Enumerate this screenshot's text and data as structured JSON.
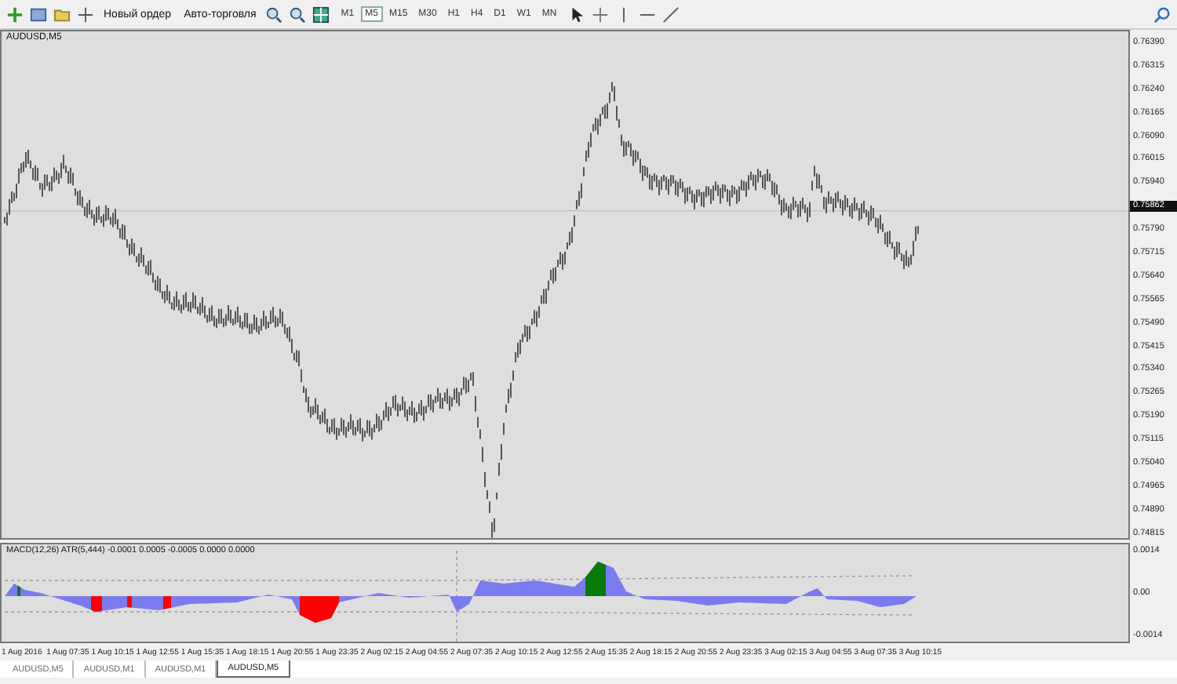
{
  "toolbar": {
    "buttons": [
      {
        "label": "Новый ордер"
      },
      {
        "label": "Авто-торговля"
      }
    ],
    "timeframes": [
      {
        "label": "M1",
        "selected": false
      },
      {
        "label": "M5",
        "selected": true
      },
      {
        "label": "M15",
        "selected": false
      },
      {
        "label": "M30",
        "selected": false
      },
      {
        "label": "H1",
        "selected": false
      },
      {
        "label": "H4",
        "selected": false
      },
      {
        "label": "D1",
        "selected": false
      },
      {
        "label": "W1",
        "selected": false
      },
      {
        "label": "MN",
        "selected": false
      }
    ]
  },
  "chart": {
    "title": "AUDUSD,M5",
    "price_axis": [
      {
        "label": "0.76390",
        "current": false
      },
      {
        "label": "0.76315",
        "current": false
      },
      {
        "label": "0.76240",
        "current": false
      },
      {
        "label": "0.76165",
        "current": false
      },
      {
        "label": "0.76090",
        "current": false
      },
      {
        "label": "0.76015",
        "current": false
      },
      {
        "label": "0.75940",
        "current": false
      },
      {
        "label": "0.75862",
        "current": true
      },
      {
        "label": "0.75790",
        "current": false
      },
      {
        "label": "0.75715",
        "current": false
      },
      {
        "label": "0.75640",
        "current": false
      },
      {
        "label": "0.75565",
        "current": false
      },
      {
        "label": "0.75490",
        "current": false
      },
      {
        "label": "0.75415",
        "current": false
      },
      {
        "label": "0.75340",
        "current": false
      },
      {
        "label": "0.75265",
        "current": false
      },
      {
        "label": "0.75190",
        "current": false
      },
      {
        "label": "0.75115",
        "current": false
      },
      {
        "label": "0.75040",
        "current": false
      },
      {
        "label": "0.74965",
        "current": false
      },
      {
        "label": "0.74890",
        "current": false
      },
      {
        "label": "0.74815",
        "current": false
      }
    ]
  },
  "indicator": {
    "title": "MACD(12,26) ATR(5,444) -0.0001 0.0005 -0.0005 0.0000 0.0000",
    "axis": [
      "0.0014",
      "0.00",
      "-0.0014"
    ]
  },
  "time_axis": [
    "1 Aug 2016",
    "1 Aug 07:35",
    "1 Aug 10:15",
    "1 Aug 12:55",
    "1 Aug 15:35",
    "1 Aug 18:15",
    "1 Aug 20:55",
    "1 Aug 23:35",
    "2 Aug 02:15",
    "2 Aug 04:55",
    "2 Aug 07:35",
    "2 Aug 10:15",
    "2 Aug 12:55",
    "2 Aug 15:35",
    "2 Aug 18:15",
    "2 Aug 20:55",
    "2 Aug 23:35",
    "3 Aug 02:15",
    "3 Aug 04:55",
    "3 Aug 07:35",
    "3 Aug 10:15"
  ],
  "tabs": [
    {
      "label": "AUDUSD,M5",
      "selected": false
    },
    {
      "label": "AUDUSD,M1",
      "selected": false
    },
    {
      "label": "AUDUSD,M1",
      "selected": false
    },
    {
      "label": "AUDUSD,M5",
      "selected": true
    }
  ]
}
